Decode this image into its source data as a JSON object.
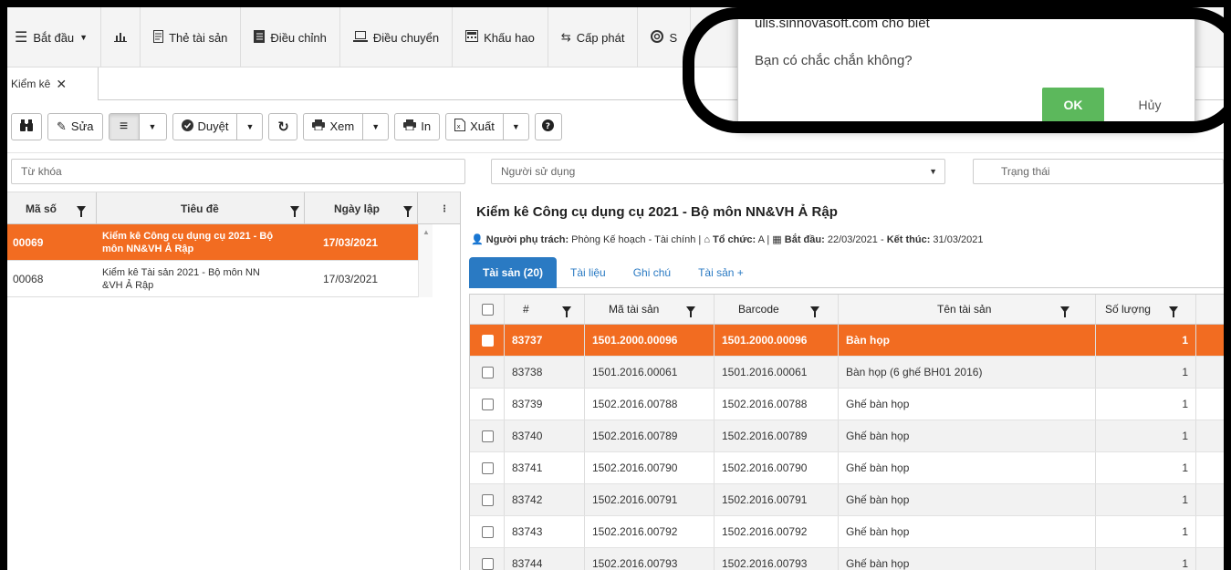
{
  "menu": [
    {
      "label": "Bắt đầu",
      "icon": "menu-icon"
    },
    {
      "label": "",
      "icon": "bar-chart-icon"
    },
    {
      "label": "Thẻ tài sản",
      "icon": "card-icon"
    },
    {
      "label": "Điều chỉnh",
      "icon": "ledger-icon"
    },
    {
      "label": "Điều chuyển",
      "icon": "laptop-icon"
    },
    {
      "label": "Khấu hao",
      "icon": "calculator-icon"
    },
    {
      "label": "Cấp phát",
      "icon": "exchange-icon"
    },
    {
      "label": "S",
      "icon": "lifebuoy-icon"
    }
  ],
  "doc_tab": {
    "label": "Kiểm kê",
    "close": "✕"
  },
  "toolbar": {
    "edit": "Sửa",
    "approve": "Duyệt",
    "view": "Xem",
    "print": "In",
    "export": "Xuất"
  },
  "filters": {
    "keyword_placeholder": "Từ khóa",
    "user_placeholder": "Người sử dụng",
    "status_placeholder": "Trạng thái"
  },
  "left_grid": {
    "columns": [
      "Mã số",
      "Tiêu đề",
      "Ngày lập"
    ],
    "rows": [
      {
        "code": "00069",
        "title_l1": "Kiểm kê Công cụ dụng cụ 2021 - Bộ",
        "title_l2": "môn NN&VH Ả Rập",
        "date": "17/03/2021",
        "selected": true
      },
      {
        "code": "00068",
        "title_l1": "Kiểm kê Tài sản 2021 - Bộ môn NN",
        "title_l2": "&VH Ả Rập",
        "date": "17/03/2021",
        "selected": false
      }
    ]
  },
  "detail": {
    "title": "Kiểm kê Công cụ dụng cụ 2021 - Bộ môn NN&VH Ả Rập",
    "owner_label": "Người phụ trách:",
    "owner_value": "Phòng Kế hoạch - Tài chính",
    "org_label": "Tổ chức:",
    "org_value": "A",
    "start_label": "Bắt đầu:",
    "start_value": "22/03/2021",
    "end_label": "Kết thúc:",
    "end_value": "31/03/2021",
    "tabs": [
      "Tài sản (20)",
      "Tài liệu",
      "Ghi chú",
      "Tài sản +"
    ]
  },
  "asset_grid": {
    "columns": [
      "#",
      "Mã tài sản",
      "Barcode",
      "Tên tài sản",
      "Số lượng"
    ],
    "rows": [
      {
        "id": "83737",
        "code": "1501.2000.00096",
        "barcode": "1501.2000.00096",
        "name": "Bàn họp",
        "qty": "1"
      },
      {
        "id": "83738",
        "code": "1501.2016.00061",
        "barcode": "1501.2016.00061",
        "name": "Bàn họp (6 ghế BH01 2016)",
        "qty": "1"
      },
      {
        "id": "83739",
        "code": "1502.2016.00788",
        "barcode": "1502.2016.00788",
        "name": "Ghế bàn họp",
        "qty": "1"
      },
      {
        "id": "83740",
        "code": "1502.2016.00789",
        "barcode": "1502.2016.00789",
        "name": "Ghế bàn họp",
        "qty": "1"
      },
      {
        "id": "83741",
        "code": "1502.2016.00790",
        "barcode": "1502.2016.00790",
        "name": "Ghế bàn họp",
        "qty": "1"
      },
      {
        "id": "83742",
        "code": "1502.2016.00791",
        "barcode": "1502.2016.00791",
        "name": "Ghế bàn họp",
        "qty": "1"
      },
      {
        "id": "83743",
        "code": "1502.2016.00792",
        "barcode": "1502.2016.00792",
        "name": "Ghế bàn họp",
        "qty": "1"
      },
      {
        "id": "83744",
        "code": "1502.2016.00793",
        "barcode": "1502.2016.00793",
        "name": "Ghế bàn họp",
        "qty": "1"
      }
    ]
  },
  "alert": {
    "title": "ulis.sinnovasoft.com cho biết",
    "message": "Bạn có chắc chắn không?",
    "ok": "OK",
    "cancel": "Hủy"
  },
  "colors": {
    "accent": "#f26c21",
    "tab_blue": "#2a7ac3",
    "ok_green": "#5cb85c"
  }
}
